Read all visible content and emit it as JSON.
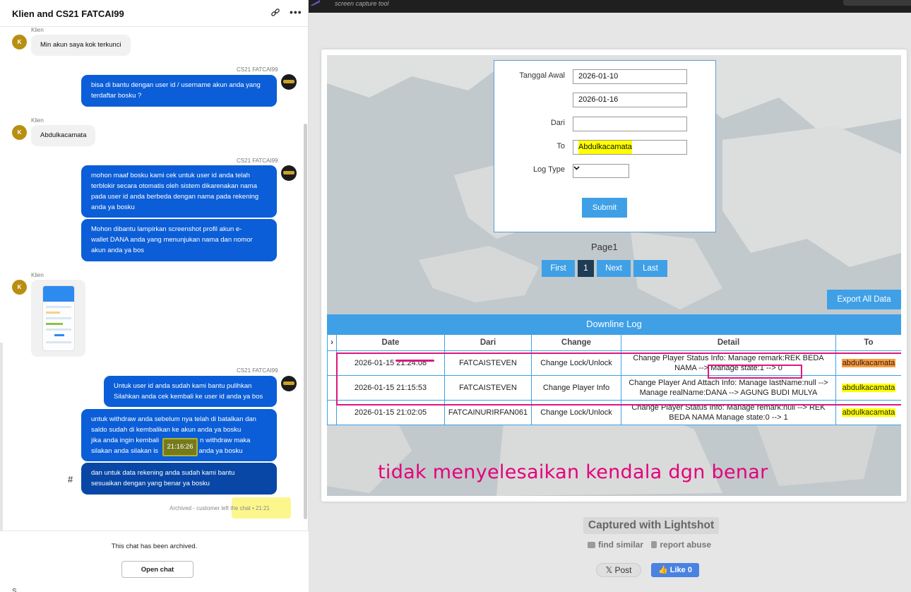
{
  "chat": {
    "title": "Klien and CS21 FATCAI99",
    "link_icon": "link-icon",
    "more_icon": "more-options-icon",
    "more_glyph": "•••",
    "avatar_initial": "K",
    "client_name": "Klien",
    "agent_name": "CS21 FATCAI99",
    "messages": [
      {
        "from": "Klien",
        "lines": [
          "Min akun saya kok terkunci"
        ]
      },
      {
        "from": "CS21 FATCAI99",
        "lines": [
          "bisa di bantu dengan user id / username akun anda yang",
          "terdaftar bosku ?"
        ]
      },
      {
        "from": "Klien",
        "lines": [
          "Abdulkacamata"
        ]
      },
      {
        "from": "CS21 FATCAI99",
        "lines": [
          "mohon maaf bosku kami cek untuk user id anda telah",
          "terblokir secara otomatis oleh sistem dikarenakan nama",
          "pada user id anda berbeda dengan nama pada rekening",
          "anda ya bosku"
        ]
      },
      {
        "from": "CS21 FATCAI99",
        "lines": [
          "Mohon dibantu lampirkan screenshot profil akun e-",
          "wallet DANA anda yang menunjukan nama dan nomor",
          "akun anda ya bos"
        ]
      },
      {
        "from": "CS21 FATCAI99",
        "lines": [
          "Untuk user id anda sudah kami bantu pulihkan",
          "Silahkan anda cek kembali ke user id anda ya bos"
        ]
      },
      {
        "from": "CS21 FATCAI99",
        "lines": [
          "untuk withdraw anda sebelum nya telah di batalkan dan",
          "saldo sudah di kembalikan ke akun anda ya bosku",
          "jika anda ingin kembali                      n withdraw maka",
          "silakan anda silakan is               raw anda ya bosku"
        ]
      },
      {
        "from": "CS21 FATCAI99",
        "lines": [
          "dan untuk data rekening anda sudah kami bantu",
          "sesuaikan dengan yang benar ya bosku"
        ]
      }
    ],
    "tooltip_time": "21:16:26",
    "hash_glyph": "#",
    "archived_note": "Archived - customer left the chat • 21:21",
    "archive_message": "This chat has been archived.",
    "open_chat_label": "Open chat",
    "bottom_letter": "S"
  },
  "lightshot": {
    "brand_subtitle": "screen capture tool",
    "filter": {
      "tanggal_awal_label": "Tanggal Awal",
      "start_date": "2026-01-10",
      "end_date": "2026-01-16",
      "dari_label": "Dari",
      "dari_value": "",
      "to_label": "To",
      "to_value": "Abdulkacamata",
      "log_type_label": "Log Type",
      "submit_label": "Submit"
    },
    "page_label": "Page1",
    "pagination": {
      "first": "First",
      "current": "1",
      "next": "Next",
      "last": "Last"
    },
    "export_label": "Export All Data",
    "table_title": "Downline Log",
    "columns": {
      "date": "Date",
      "dari": "Dari",
      "change": "Change",
      "detail": "Detail",
      "to": "To"
    },
    "rows": [
      {
        "date": "2026-01-15 21:24:08",
        "dari": "FATCAISTEVEN",
        "change": "Change Lock/Unlock",
        "detail_a": "Change Player Status Info: Manage remark:REK BEDA NAMA -->",
        "detail_b": "Manage state:1 --> 0",
        "to": "abdulkacamata"
      },
      {
        "date": "2026-01-15 21:15:53",
        "dari": "FATCAISTEVEN",
        "change": "Change Player Info",
        "detail": "Change Player And Attach Info: Manage lastName:null --> Manage realName:DANA --> AGUNG BUDI MULYA",
        "to": "abdulkacamata"
      },
      {
        "date": "2026-01-15 21:02:05",
        "dari": "FATCAINURIRFAN061",
        "change": "Change Lock/Unlock",
        "detail": "Change Player Status Info: Manage remark:null --> REK BEDA NAMA Manage state:0 --> 1",
        "to": "abdulkacamata"
      }
    ],
    "annotation": "tidak menyelesaikan kendala dgn benar",
    "captured_label": "Captured with Lightshot",
    "find_similar": "find similar",
    "report_abuse": "report abuse",
    "post_label": "𝕏 Post",
    "like_label": "👍 Like 0",
    "colors": {
      "accent": "#3fa0e6",
      "annotation": "#e4007c",
      "highlight": "#ffff00",
      "orange": "#ff9a3c",
      "chat_blue": "#0b5ed7"
    }
  }
}
